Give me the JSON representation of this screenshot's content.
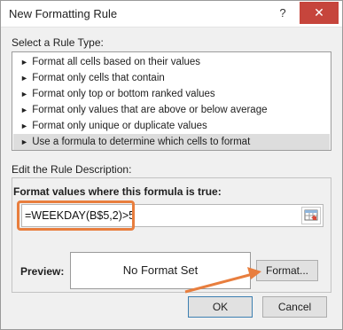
{
  "window": {
    "title": "New Formatting Rule",
    "help_label": "?",
    "close_label": "✕"
  },
  "rule_type": {
    "label": "Select a Rule Type:",
    "items": [
      {
        "label": "Format all cells based on their values"
      },
      {
        "label": "Format only cells that contain"
      },
      {
        "label": "Format only top or bottom ranked values"
      },
      {
        "label": "Format only values that are above or below average"
      },
      {
        "label": "Format only unique or duplicate values"
      },
      {
        "label": "Use a formula to determine which cells to format",
        "selected": true
      }
    ]
  },
  "description": {
    "label": "Edit the Rule Description:",
    "formula_label": "Format values where this formula is true:",
    "formula_value": "=WEEKDAY(B$5,2)>5"
  },
  "preview": {
    "label": "Preview:",
    "text": "No Format Set"
  },
  "buttons": {
    "format": "Format...",
    "ok": "OK",
    "cancel": "Cancel"
  },
  "colors": {
    "highlight": "#e87e3e",
    "selected_row": "#dddddd",
    "close_button": "#c6453c"
  },
  "icons": {
    "rule_bullet": "arrow-right-icon",
    "collapse": "collapse-dialog-icon"
  }
}
